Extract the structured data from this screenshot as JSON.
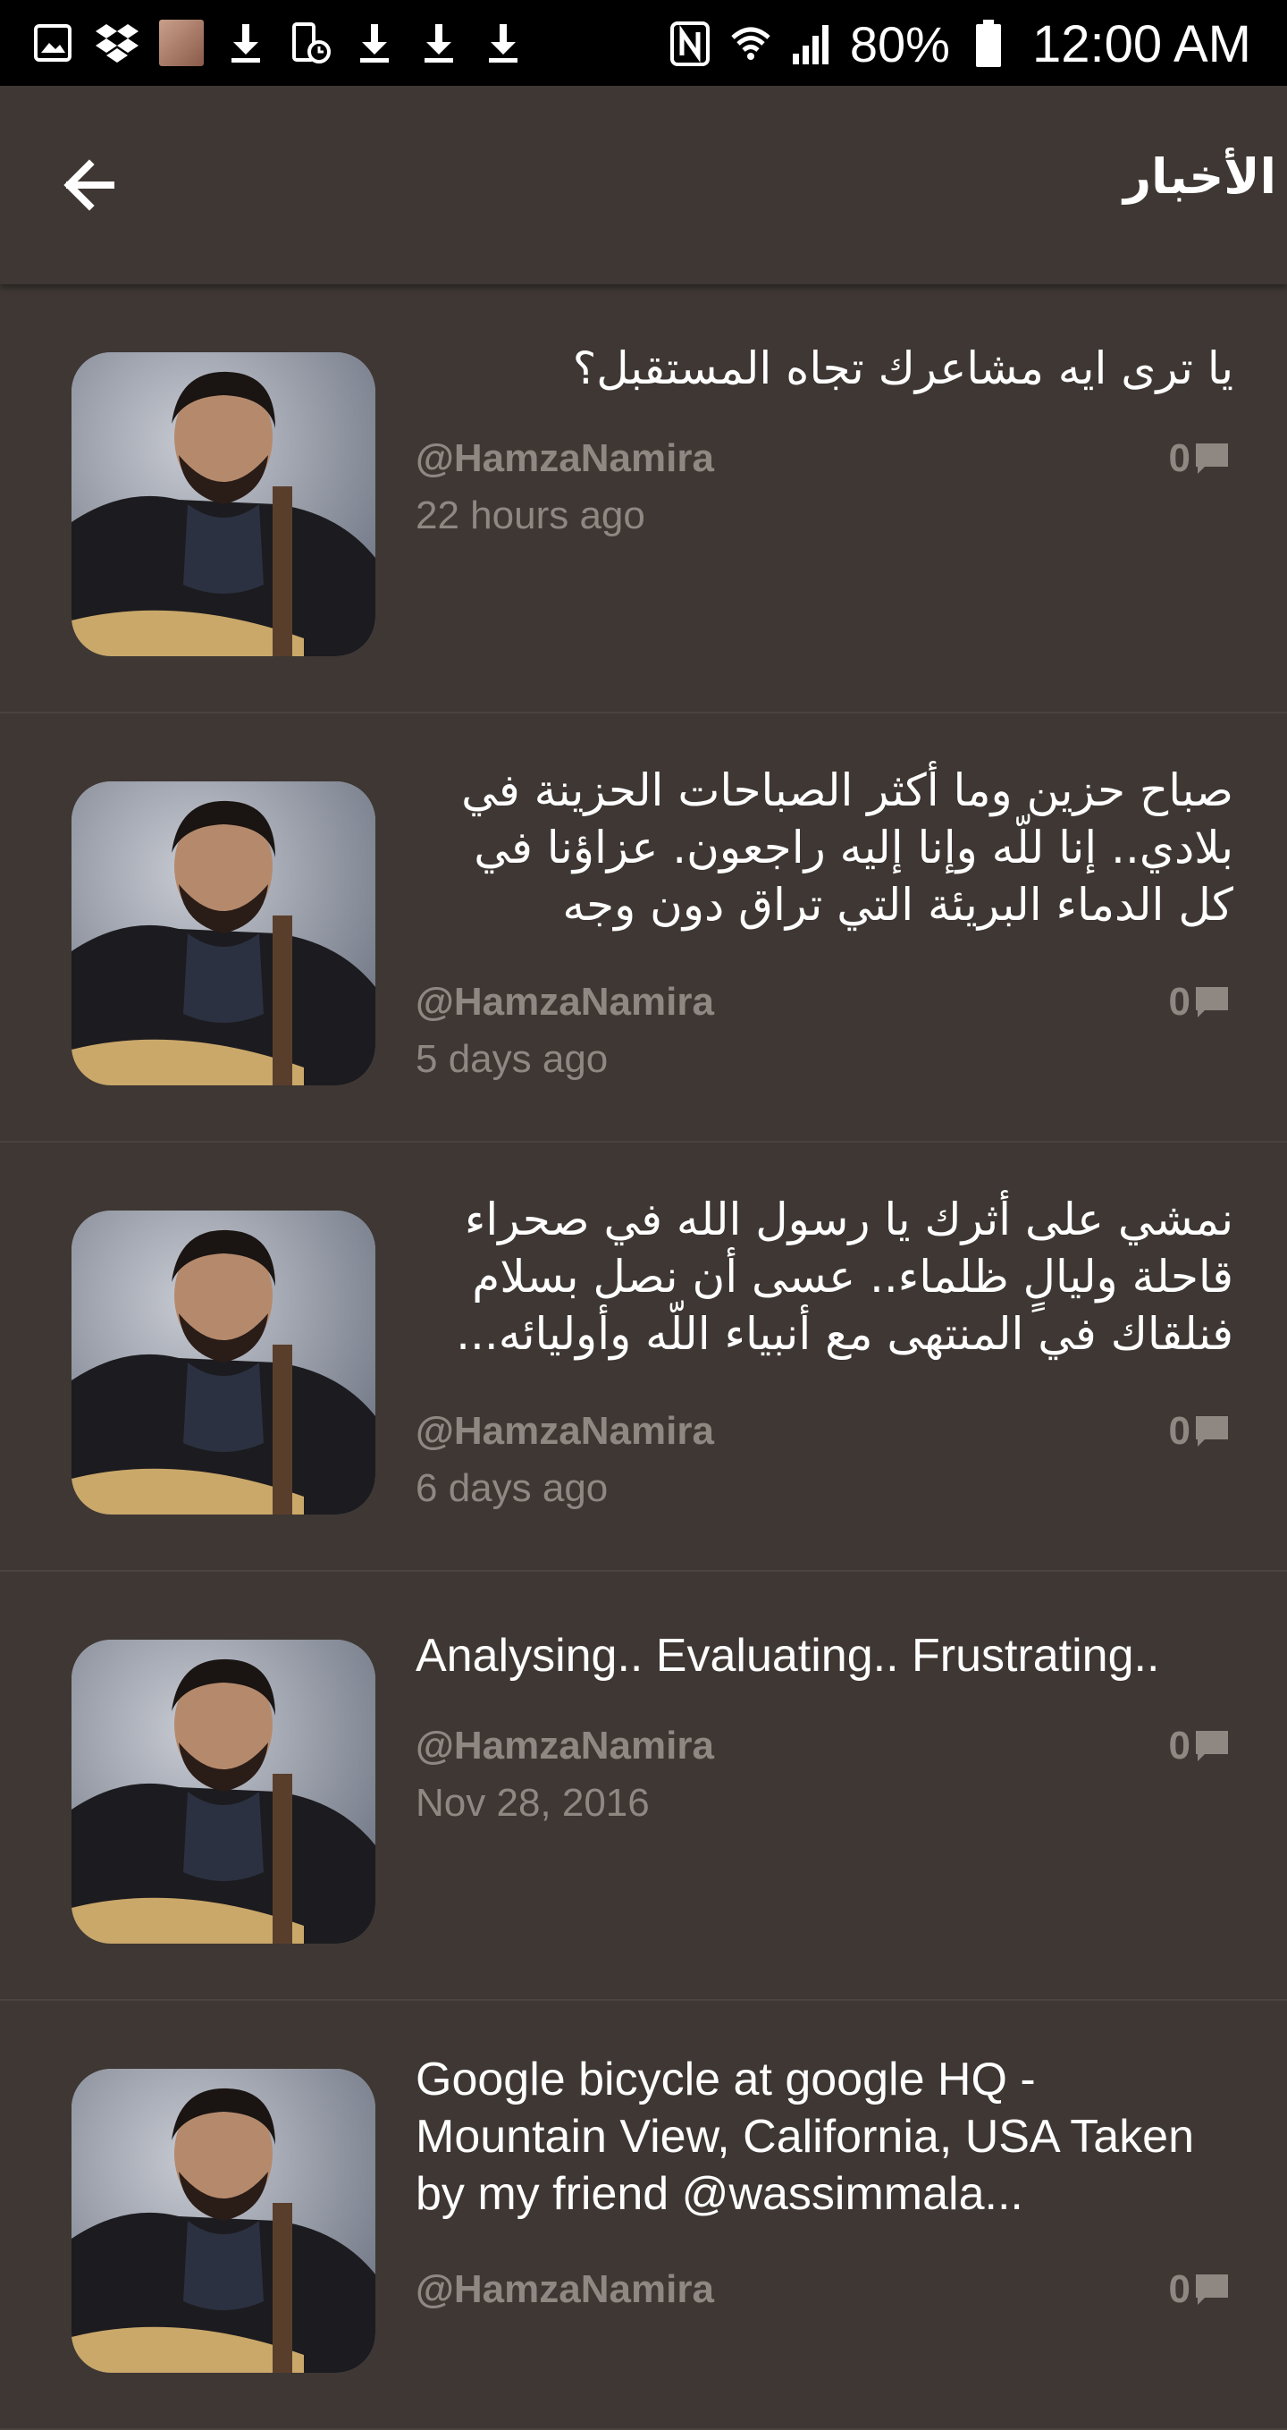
{
  "status_bar": {
    "battery": "80%",
    "time": "12:00 AM",
    "icons": [
      "gallery-icon",
      "dropbox-icon",
      "album-thumbnail",
      "download-icon",
      "screen-record-icon",
      "download-icon",
      "download-icon",
      "download-icon",
      "nfc-icon",
      "wifi-icon",
      "signal-icon",
      "battery-icon"
    ]
  },
  "app_bar": {
    "title": "الأخبار",
    "back_icon": "arrow-left-icon"
  },
  "feed": [
    {
      "text": "يا ترى ايه مشاعرك تجاه المستقبل؟",
      "dir": "rtl",
      "handle": "@HamzaNamira",
      "time": "22 hours ago",
      "comments": "0"
    },
    {
      "text": "صباح حزين وما أكثر الصباحات الحزينة في بلادي.. إنا للّه وإنا إليه راجعون. عزاؤنا في كل الدماء البريئة التي تراق دون وجه",
      "dir": "rtl",
      "handle": "@HamzaNamira",
      "time": "5 days ago",
      "comments": "0"
    },
    {
      "text": "نمشي على أثرك يا رسول الله في صحراء قاحلة وليالٍ ظلماء.. عسى أن نصل بسلام فنلقاك في المنتهى مع أنبياء اللّه وأوليائه...",
      "dir": "rtl",
      "handle": "@HamzaNamira",
      "time": "6 days ago",
      "comments": "0"
    },
    {
      "text": "Analysing.. Evaluating.. Frustrating..",
      "dir": "ltr",
      "handle": "@HamzaNamira",
      "time": "Nov 28, 2016",
      "comments": "0"
    },
    {
      "text": "Google bicycle at google HQ - Mountain View,  California, USA Taken by my friend @wassimmala...",
      "dir": "ltr",
      "handle": "@HamzaNamira",
      "time": "",
      "comments": "0"
    }
  ],
  "colors": {
    "background": "#3e3733",
    "status_bar": "#000000",
    "secondary_text": "#8f8781",
    "primary_text": "#ffffff"
  }
}
